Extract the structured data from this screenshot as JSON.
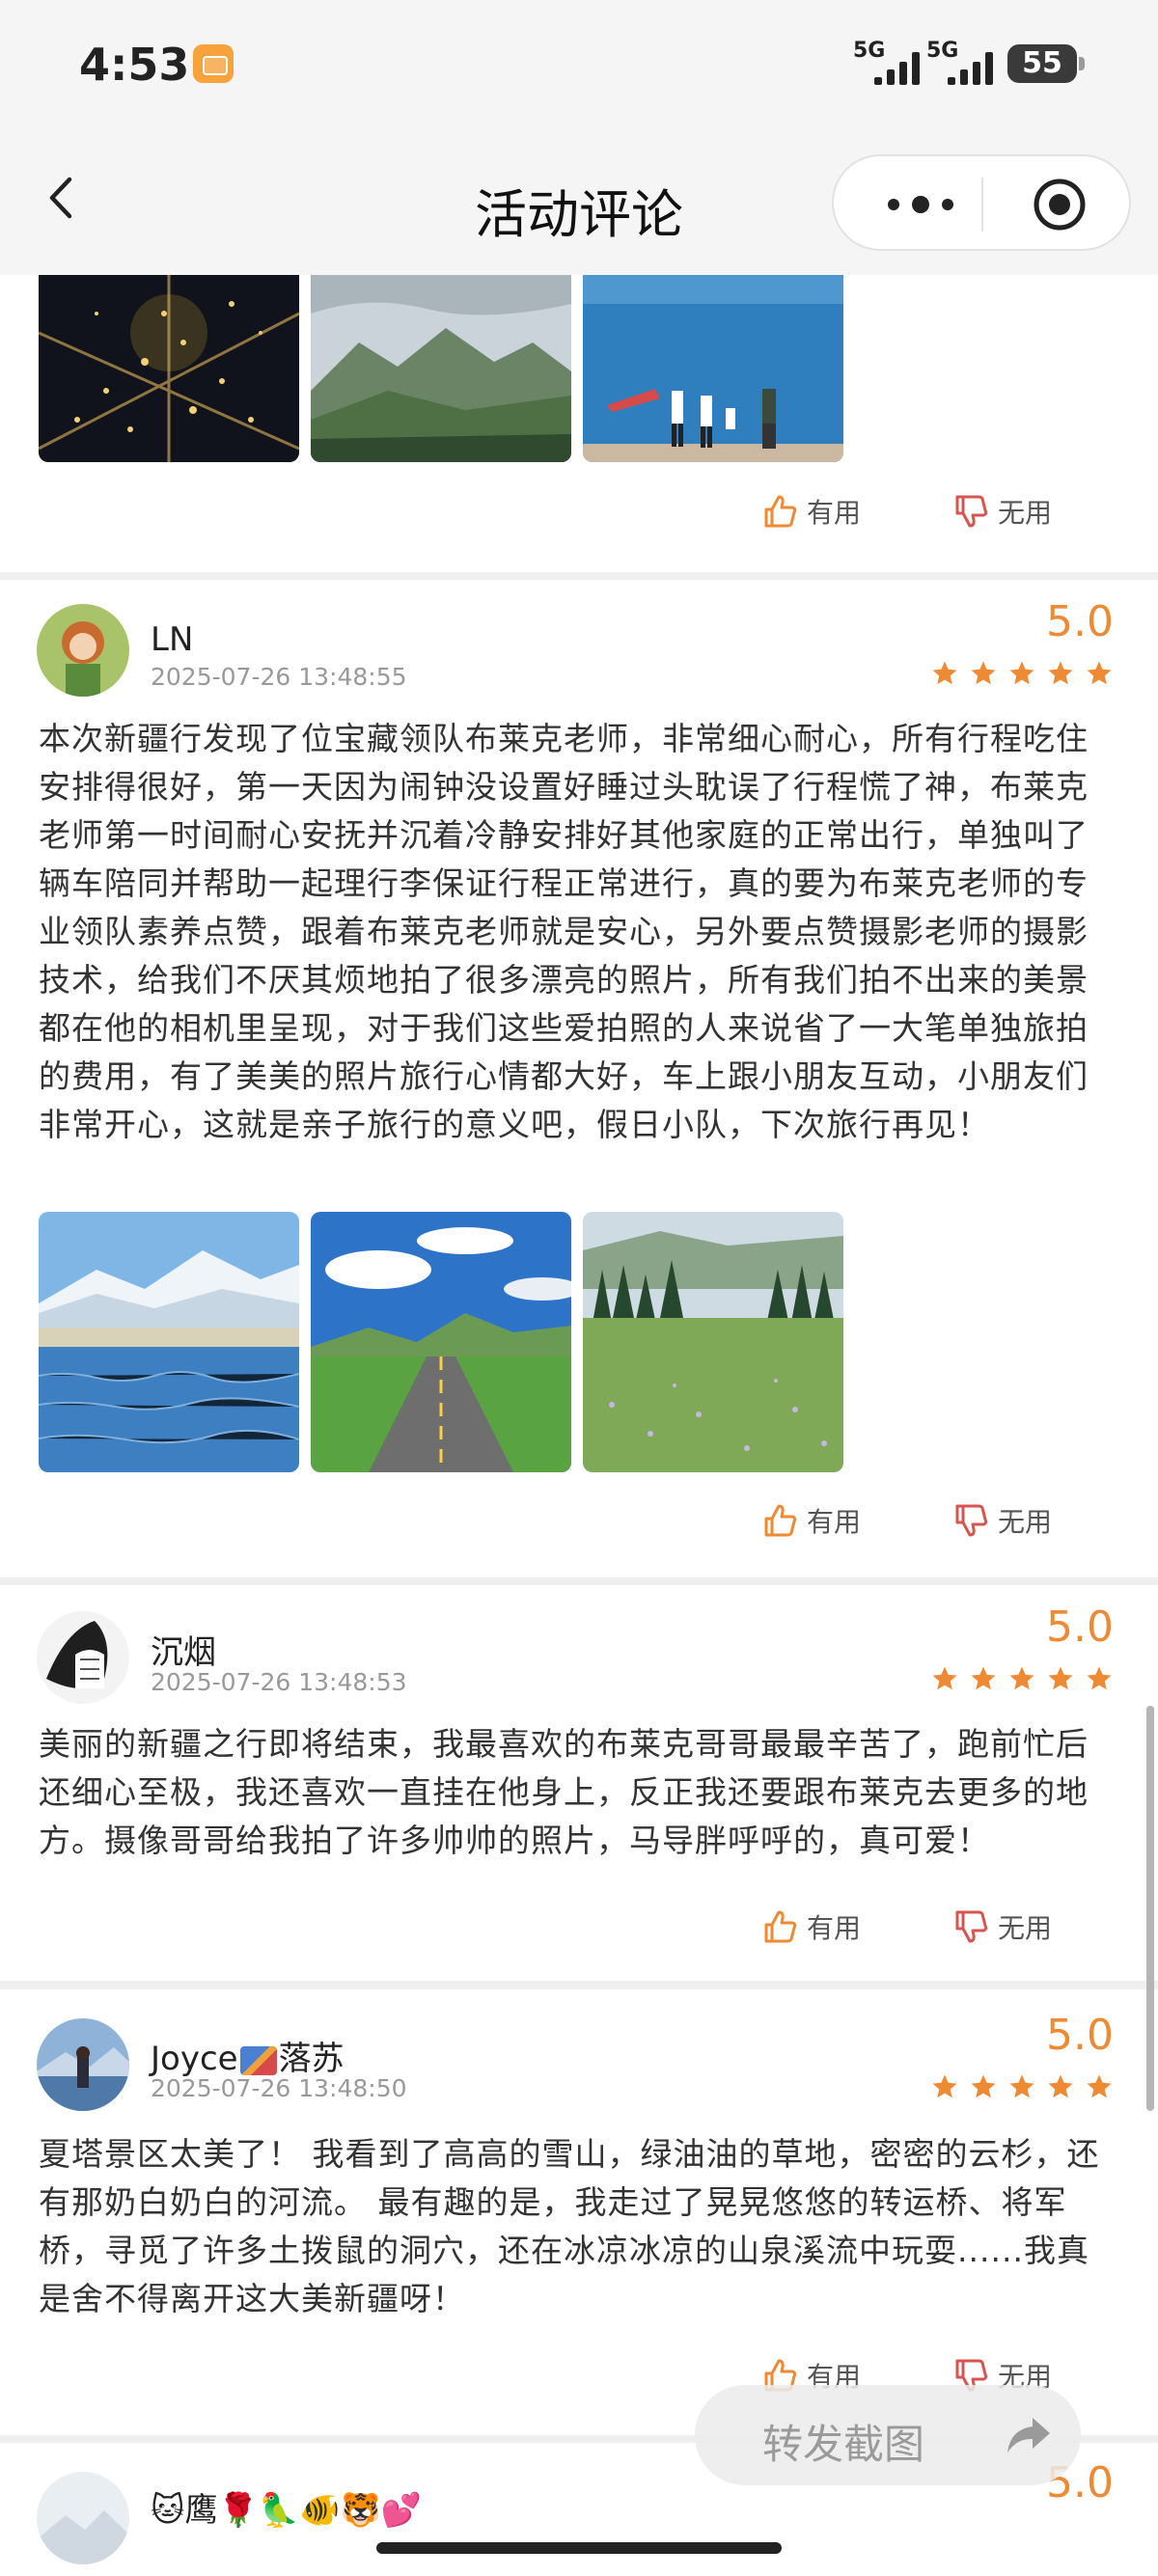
{
  "status_bar": {
    "time": "4:53",
    "signal_1": "5G",
    "signal_2": "5G",
    "battery": "55"
  },
  "nav": {
    "title": "活动评论",
    "more_icon": "more-dots-icon",
    "close_icon": "target-circle-icon"
  },
  "actions": {
    "useful": "有用",
    "useless": "无用"
  },
  "accent_color": "#ee8a33",
  "reviews": [
    {
      "user": "LN",
      "date": "2025-07-26 13:48:55",
      "score": "5.0",
      "stars": 5,
      "text": "本次新疆行发现了位宝藏领队布莱克老师，非常细心耐心，所有行程吃住安排得很好，第一天因为闹钟没设置好睡过头耽误了行程慌了神，布莱克老师第一时间耐心安抚并沉着冷静安排好其他家庭的正常出行，单独叫了辆车陪同并帮助一起理行李保证行程正常进行，真的要为布莱克老师的专业领队素养点赞，跟着布莱克老师就是安心，另外要点赞摄影老师的摄影技术，给我们不厌其烦地拍了很多漂亮的照片，所有我们拍不出来的美景都在他的相机里呈现，对于我们这些爱拍照的人来说省了一大笔单独旅拍的费用，有了美美的照片旅行心情都大好，车上跟小朋友互动，小朋友们非常开心，这就是亲子旅行的意义吧，假日小队，下次旅行再见！"
    },
    {
      "user": "沉烟",
      "date": "2025-07-26 13:48:53",
      "score": "5.0",
      "stars": 5,
      "text": "美丽的新疆之行即将结束，我最喜欢的布莱克哥哥最最辛苦了，跑前忙后还细心至极，我还喜欢一直挂在他身上，反正我还要跟布莱克去更多的地方。摄像哥哥给我拍了许多帅帅的照片，马导胖呼呼的，真可爱！"
    },
    {
      "user": "Joyce",
      "user_suffix": "落苏",
      "date": "2025-07-26 13:48:50",
      "score": "5.0",
      "stars": 5,
      "text": "夏塔景区太美了！ 我看到了高高的雪山，绿油油的草地，密密的云杉，还有那奶白奶白的河流。 最有趣的是，我走过了晃晃悠悠的转运桥、将军桥，寻觅了许多土拨鼠的洞穴，还在冰凉冰凉的山泉溪流中玩耍......我真是舍不得离开这大美新疆呀！"
    },
    {
      "user": "🐱鹰🌹🦜🐠🐯💕",
      "score": "5.0"
    }
  ],
  "float_button": {
    "label": "转发截图",
    "icon": "share-arrow-icon"
  }
}
